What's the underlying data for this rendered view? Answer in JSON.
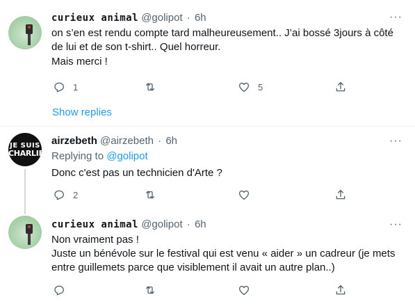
{
  "tweets": [
    {
      "name": "curieux animal",
      "handle": "@golipot",
      "sep": "·",
      "time": "6h",
      "lines": [
        "on s’en est rendu compte tard malheureusement.. J’ai bossé 3jours à côté",
        "de lui et de son t-shirt.. Quel horreur.",
        "Mais merci !"
      ],
      "replies": "1",
      "retweets": "",
      "likes": "5"
    },
    {
      "name": "airzebeth",
      "handle": "@airzebeth",
      "sep": "·",
      "time": "6h",
      "replying_prefix": "Replying to ",
      "replying_handle": "@golipot",
      "lines": [
        "Donc c'est pas un technicien d'Arte ?"
      ],
      "replies": "2",
      "retweets": "",
      "likes": "",
      "avatar_text": [
        "JE SUIS",
        "CHARLIE"
      ]
    },
    {
      "name": "curieux animal",
      "handle": "@golipot",
      "sep": "·",
      "time": "6h",
      "lines": [
        "Non vraiment pas !",
        "Juste un bénévole sur le festival qui est venu « aider » un cadreur (je mets",
        "entre guillemets parce que visiblement il avait un autre plan..)"
      ],
      "replies": "",
      "retweets": "",
      "likes": ""
    }
  ],
  "show_replies": "Show replies",
  "more_label": "···",
  "icons": {
    "reply": "reply-icon",
    "retweet": "retweet-icon",
    "like": "heart-icon",
    "share": "share-icon",
    "more": "more-icon"
  },
  "colors": {
    "link": "#1d9bf0",
    "secondary": "#536471",
    "text": "#0f1419",
    "divider": "#eff3f4"
  }
}
